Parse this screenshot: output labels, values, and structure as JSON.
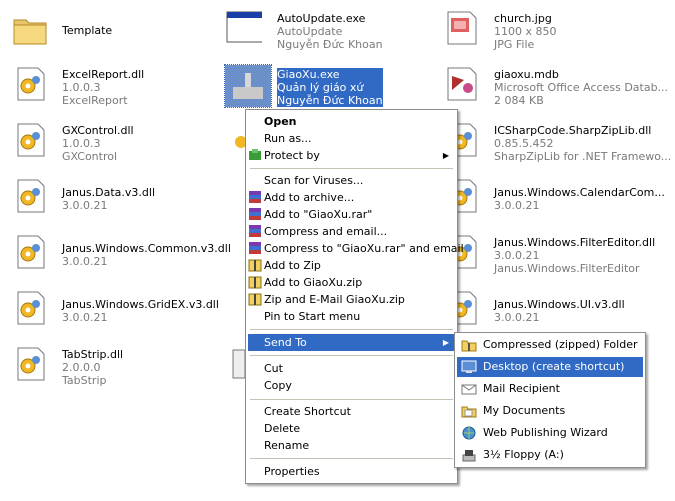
{
  "files": [
    {
      "key": "template",
      "name": "Template",
      "sub1": "",
      "sub2": "",
      "icon": "folder-icon"
    },
    {
      "key": "autoupdate",
      "name": "AutoUpdate.exe",
      "sub1": "AutoUpdate",
      "sub2": "Nguyễn Đức Khoan",
      "icon": "application-window-icon"
    },
    {
      "key": "church",
      "name": "church.jpg",
      "sub1": "1100 x 850",
      "sub2": "JPG File",
      "icon": "image-file-icon"
    },
    {
      "key": "excelreport",
      "name": "ExcelReport.dll",
      "sub1": "1.0.0.3",
      "sub2": "ExcelReport",
      "icon": "dll-file-icon"
    },
    {
      "key": "giaoxu-exe",
      "name": "GiaoXu.exe",
      "sub1": "Quản lý giáo xứ",
      "sub2": "Nguyễn Đức Khoan",
      "icon": "church-app-icon"
    },
    {
      "key": "giaoxu-mdb",
      "name": "giaoxu.mdb",
      "sub1": "Microsoft Office Access Datab...",
      "sub2": "2 084 KB",
      "icon": "access-database-icon"
    },
    {
      "key": "gxcontrol",
      "name": "GXControl.dll",
      "sub1": "1.0.0.3",
      "sub2": "GXControl",
      "icon": "dll-file-icon"
    },
    {
      "key": "sharpziplib",
      "name": "ICSharpCode.SharpZipLib.dll",
      "sub1": "0.85.5.452",
      "sub2": "SharpZipLib for .NET Framewo...",
      "icon": "dll-file-icon"
    },
    {
      "key": "janus-data",
      "name": "Janus.Data.v3.dll",
      "sub1": "3.0.0.21",
      "sub2": "",
      "icon": "dll-file-icon"
    },
    {
      "key": "janus-calendar",
      "name": "Janus.Windows.CalendarCom...",
      "sub1": "3.0.0.21",
      "sub2": "",
      "icon": "dll-file-icon"
    },
    {
      "key": "janus-common",
      "name": "Janus.Windows.Common.v3.dll",
      "sub1": "3.0.0.21",
      "sub2": "",
      "icon": "dll-file-icon"
    },
    {
      "key": "janus-filtereditor",
      "name": "Janus.Windows.FilterEditor.dll",
      "sub1": "3.0.0.21",
      "sub2": "Janus.Windows.FilterEditor",
      "icon": "dll-file-icon"
    },
    {
      "key": "janus-gridex",
      "name": "Janus.Windows.GridEX.v3.dll",
      "sub1": "3.0.0.21",
      "sub2": "",
      "icon": "dll-file-icon"
    },
    {
      "key": "janus-ui",
      "name": "Janus.Windows.UI.v3.dll",
      "sub1": "3.0.0.21",
      "sub2": "",
      "icon": "dll-file-icon"
    },
    {
      "key": "tabstrip",
      "name": "TabStrip.dll",
      "sub1": "2.0.0.0",
      "sub2": "TabStrip",
      "icon": "dll-file-icon"
    }
  ],
  "context_menu": {
    "open": "Open",
    "run_as": "Run as...",
    "protect_by": "Protect by",
    "scan_viruses": "Scan for Viruses...",
    "add_archive": "Add to archive...",
    "add_rar": "Add to \"GiaoXu.rar\"",
    "compress_email": "Compress and email...",
    "compress_rar_email": "Compress to \"GiaoXu.rar\" and email",
    "add_zip": "Add to Zip",
    "add_giaoxu_zip": "Add to GiaoXu.zip",
    "zip_email": "Zip and E-Mail GiaoXu.zip",
    "pin_start": "Pin to Start menu",
    "send_to": "Send To",
    "cut": "Cut",
    "copy": "Copy",
    "create_shortcut": "Create Shortcut",
    "delete": "Delete",
    "rename": "Rename",
    "properties": "Properties"
  },
  "send_to_menu": {
    "compressed_folder": "Compressed (zipped) Folder",
    "desktop_shortcut": "Desktop (create shortcut)",
    "mail_recipient": "Mail Recipient",
    "my_documents": "My Documents",
    "web_publishing": "Web Publishing Wizard",
    "floppy": "3½ Floppy (A:)"
  },
  "colors": {
    "selection": "#316ac5",
    "subtext": "#7a7a7a",
    "menu_border": "#8d8d8d"
  }
}
